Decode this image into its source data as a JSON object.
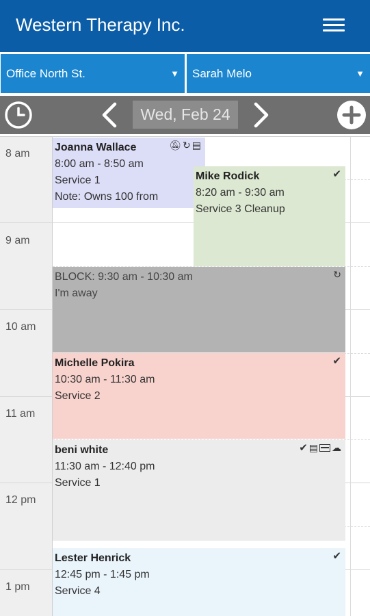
{
  "app": {
    "title": "Western Therapy Inc."
  },
  "filters": {
    "location": "Office North St.",
    "staff": "Sarah Melo"
  },
  "datebar": {
    "date": "Wed, Feb 24"
  },
  "hours": [
    "8 am",
    "9 am",
    "10 am",
    "11 am",
    "12 pm",
    "1 pm"
  ],
  "appointments": [
    {
      "name": "Joanna Wallace",
      "time": "8:00 am - 8:50 am",
      "service": "Service 1",
      "note": "Note: Owns 100 from",
      "color": "#dcddf7",
      "icons": [
        "bell-off-icon",
        "recurring-icon",
        "notes-icon"
      ]
    },
    {
      "name": "Mike Rodick",
      "time": "8:20 am - 9:30 am",
      "service": "Service 3 Cleanup",
      "color": "#dce8d1",
      "icons": [
        "check-icon"
      ]
    },
    {
      "title": "BLOCK: 9:30 am - 10:30 am",
      "note": "I'm away",
      "color": "#b3b3b3",
      "icons": [
        "recurring-icon"
      ]
    },
    {
      "name": "Michelle Pokira",
      "time": "10:30 am - 11:30 am",
      "service": "Service 2",
      "color": "#f8d2cd",
      "icons": [
        "check-icon"
      ]
    },
    {
      "name": "beni white",
      "time": "11:30 am - 12:40 pm",
      "service": "Service 1",
      "color": "#ececec",
      "icons": [
        "check-icon",
        "notes-icon",
        "card-icon",
        "cloud-icon"
      ]
    },
    {
      "name": "Lester Henrick",
      "time": "12:45 pm - 1:45 pm",
      "service": "Service 4",
      "color": "#eaf4fb",
      "icons": [
        "check-icon"
      ]
    }
  ]
}
